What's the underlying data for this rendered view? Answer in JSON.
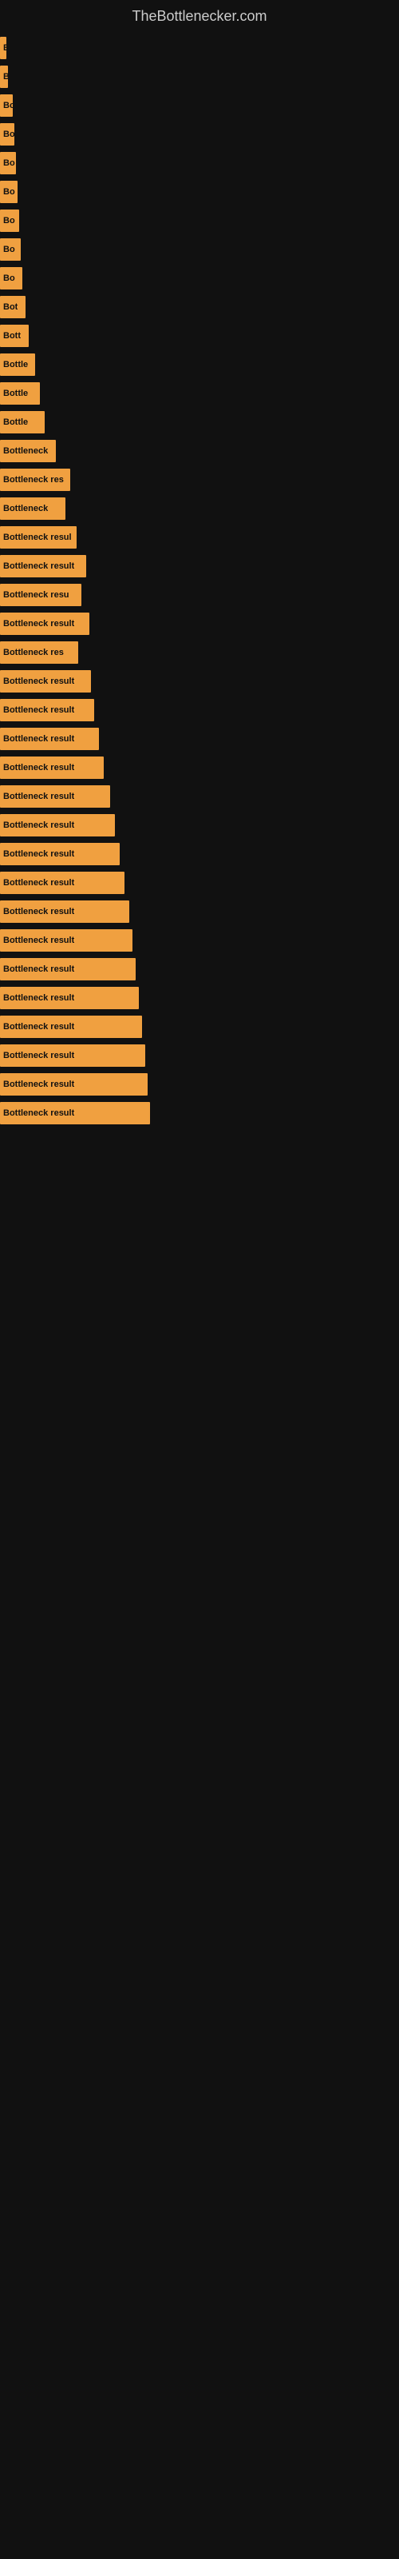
{
  "site": {
    "title": "TheBottlenecker.com"
  },
  "bars": [
    {
      "id": 1,
      "width": 8,
      "label": "B"
    },
    {
      "id": 2,
      "width": 10,
      "label": "B"
    },
    {
      "id": 3,
      "width": 16,
      "label": "Bo"
    },
    {
      "id": 4,
      "width": 18,
      "label": "Bo"
    },
    {
      "id": 5,
      "width": 20,
      "label": "Bo"
    },
    {
      "id": 6,
      "width": 22,
      "label": "Bo"
    },
    {
      "id": 7,
      "width": 24,
      "label": "Bo"
    },
    {
      "id": 8,
      "width": 26,
      "label": "Bo"
    },
    {
      "id": 9,
      "width": 28,
      "label": "Bo"
    },
    {
      "id": 10,
      "width": 32,
      "label": "Bot"
    },
    {
      "id": 11,
      "width": 36,
      "label": "Bott"
    },
    {
      "id": 12,
      "width": 44,
      "label": "Bottle"
    },
    {
      "id": 13,
      "width": 50,
      "label": "Bottle"
    },
    {
      "id": 14,
      "width": 56,
      "label": "Bottle"
    },
    {
      "id": 15,
      "width": 70,
      "label": "Bottleneck"
    },
    {
      "id": 16,
      "width": 88,
      "label": "Bottleneck res"
    },
    {
      "id": 17,
      "width": 82,
      "label": "Bottleneck"
    },
    {
      "id": 18,
      "width": 96,
      "label": "Bottleneck resul"
    },
    {
      "id": 19,
      "width": 108,
      "label": "Bottleneck result"
    },
    {
      "id": 20,
      "width": 102,
      "label": "Bottleneck resu"
    },
    {
      "id": 21,
      "width": 112,
      "label": "Bottleneck result"
    },
    {
      "id": 22,
      "width": 98,
      "label": "Bottleneck res"
    },
    {
      "id": 23,
      "width": 114,
      "label": "Bottleneck result"
    },
    {
      "id": 24,
      "width": 118,
      "label": "Bottleneck result"
    },
    {
      "id": 25,
      "width": 124,
      "label": "Bottleneck result"
    },
    {
      "id": 26,
      "width": 130,
      "label": "Bottleneck result"
    },
    {
      "id": 27,
      "width": 138,
      "label": "Bottleneck result"
    },
    {
      "id": 28,
      "width": 144,
      "label": "Bottleneck result"
    },
    {
      "id": 29,
      "width": 150,
      "label": "Bottleneck result"
    },
    {
      "id": 30,
      "width": 156,
      "label": "Bottleneck result"
    },
    {
      "id": 31,
      "width": 162,
      "label": "Bottleneck result"
    },
    {
      "id": 32,
      "width": 166,
      "label": "Bottleneck result"
    },
    {
      "id": 33,
      "width": 170,
      "label": "Bottleneck result"
    },
    {
      "id": 34,
      "width": 174,
      "label": "Bottleneck result"
    },
    {
      "id": 35,
      "width": 178,
      "label": "Bottleneck result"
    },
    {
      "id": 36,
      "width": 182,
      "label": "Bottleneck result"
    },
    {
      "id": 37,
      "width": 185,
      "label": "Bottleneck result"
    },
    {
      "id": 38,
      "width": 188,
      "label": "Bottleneck result"
    }
  ]
}
